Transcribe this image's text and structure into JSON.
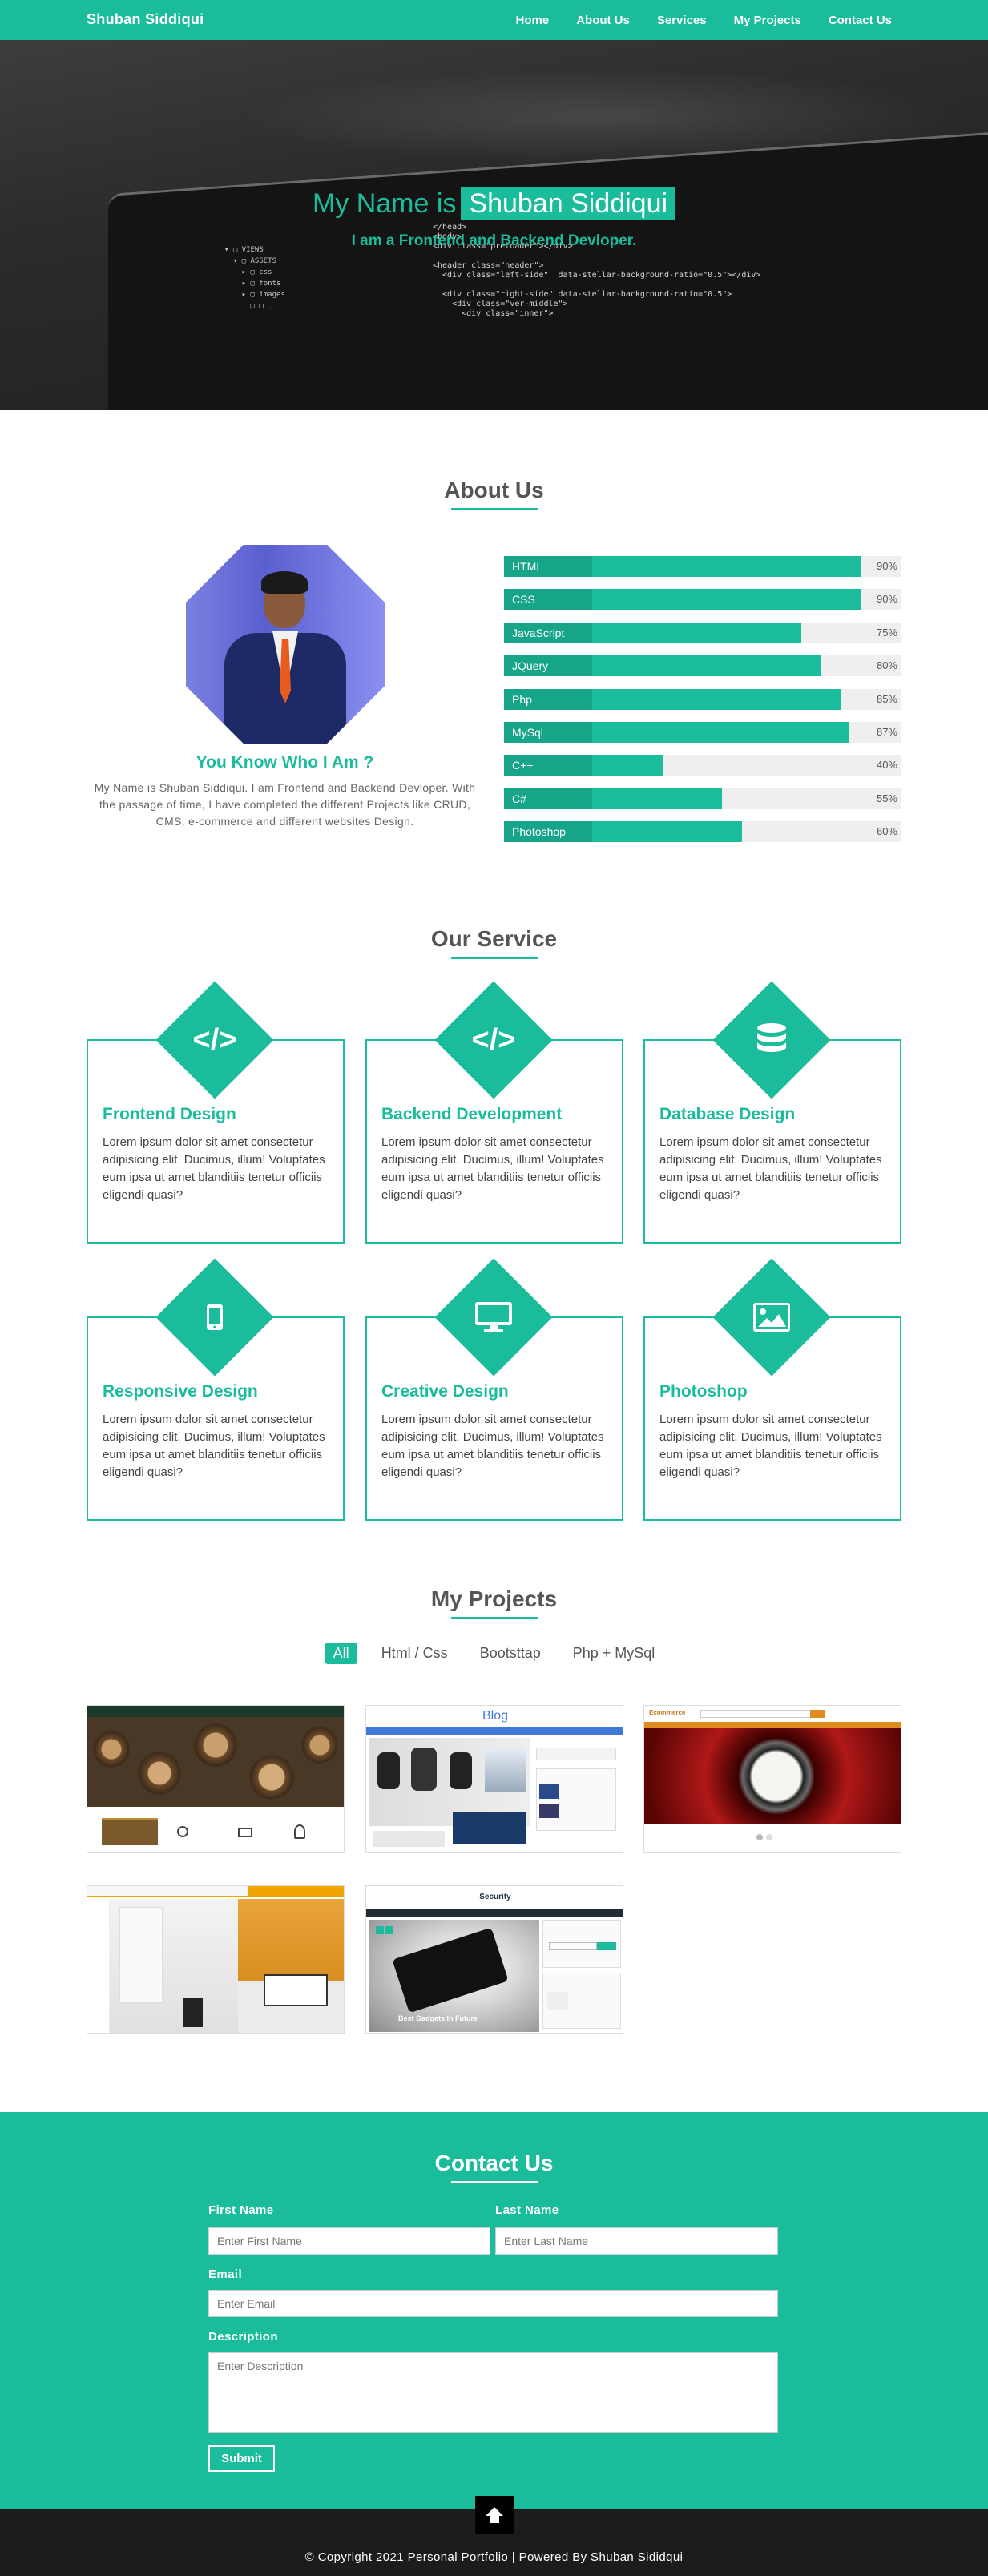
{
  "nav": {
    "brand": "Shuban Siddiqui",
    "links": [
      "Home",
      "About Us",
      "Services",
      "My Projects",
      "Contact Us"
    ]
  },
  "hero": {
    "title_prefix": "My Name is",
    "name": "Shuban Siddiqui",
    "subtitle": "I am a Frontend and Backend Devloper."
  },
  "about": {
    "heading": "About Us",
    "question": "You Know Who I Am ?",
    "text": "My Name is Shuban Siddiqui. I am Frontend and Backend Devloper. With the passage of time, I have completed the different Projects like CRUD, CMS, e-commerce and different websites Design.",
    "skills": [
      {
        "name": "HTML",
        "percent": "90%",
        "value": 90
      },
      {
        "name": "CSS",
        "percent": "90%",
        "value": 90
      },
      {
        "name": "JavaScript",
        "percent": "75%",
        "value": 75
      },
      {
        "name": "JQuery",
        "percent": "80%",
        "value": 80
      },
      {
        "name": "Php",
        "percent": "85%",
        "value": 85
      },
      {
        "name": "MySql",
        "percent": "87%",
        "value": 87
      },
      {
        "name": "C++",
        "percent": "40%",
        "value": 40
      },
      {
        "name": "C#",
        "percent": "55%",
        "value": 55
      },
      {
        "name": "Photoshop",
        "percent": "60%",
        "value": 60
      }
    ]
  },
  "services": {
    "heading": "Our Service",
    "items": [
      {
        "title": "Frontend Design",
        "icon": "code-icon",
        "text": "Lorem ipsum dolor sit amet consectetur adipisicing elit. Ducimus, illum! Voluptates eum ipsa ut amet blanditiis tenetur officiis eligendi quasi?"
      },
      {
        "title": "Backend Development",
        "icon": "code-icon",
        "text": "Lorem ipsum dolor sit amet consectetur adipisicing elit. Ducimus, illum! Voluptates eum ipsa ut amet blanditiis tenetur officiis eligendi quasi?"
      },
      {
        "title": "Database Design",
        "icon": "database-icon",
        "text": "Lorem ipsum dolor sit amet consectetur adipisicing elit. Ducimus, illum! Voluptates eum ipsa ut amet blanditiis tenetur officiis eligendi quasi?"
      },
      {
        "title": "Responsive Design",
        "icon": "mobile-icon",
        "text": "Lorem ipsum dolor sit amet consectetur adipisicing elit. Ducimus, illum! Voluptates eum ipsa ut amet blanditiis tenetur officiis eligendi quasi?"
      },
      {
        "title": "Creative Design",
        "icon": "desktop-icon",
        "text": "Lorem ipsum dolor sit amet consectetur adipisicing elit. Ducimus, illum! Voluptates eum ipsa ut amet blanditiis tenetur officiis eligendi quasi?"
      },
      {
        "title": "Photoshop",
        "icon": "image-icon",
        "text": "Lorem ipsum dolor sit amet consectetur adipisicing elit. Ducimus, illum! Voluptates eum ipsa ut amet blanditiis tenetur officiis eligendi quasi?"
      }
    ]
  },
  "projects": {
    "heading": "My Projects",
    "filters": [
      "All",
      "Html / Css",
      "Bootsttap",
      "Php + MySql"
    ],
    "active_filter": "All",
    "thumb_texts": {
      "p2_title": "Blog",
      "p5_brand": "Security",
      "p5_caption": "Best Gadgets In Future",
      "p3_brand": "Ecommerce"
    }
  },
  "contact": {
    "heading": "Contact Us",
    "first_name_label": "First Name",
    "first_name_placeholder": "Enter First Name",
    "last_name_label": "Last Name",
    "last_name_placeholder": "Enter Last Name",
    "email_label": "Email",
    "email_placeholder": "Enter Email",
    "description_label": "Description",
    "description_placeholder": "Enter Description",
    "submit_label": "Submit"
  },
  "footer": {
    "copyright": "© Copyright 2021 Personal Portfolio | Powered By Shuban Sididqui",
    "scroll_icon": "arrow-up-icon"
  },
  "colors": {
    "accent": "#1abc9c",
    "footer_bg": "#1c1c1c"
  }
}
